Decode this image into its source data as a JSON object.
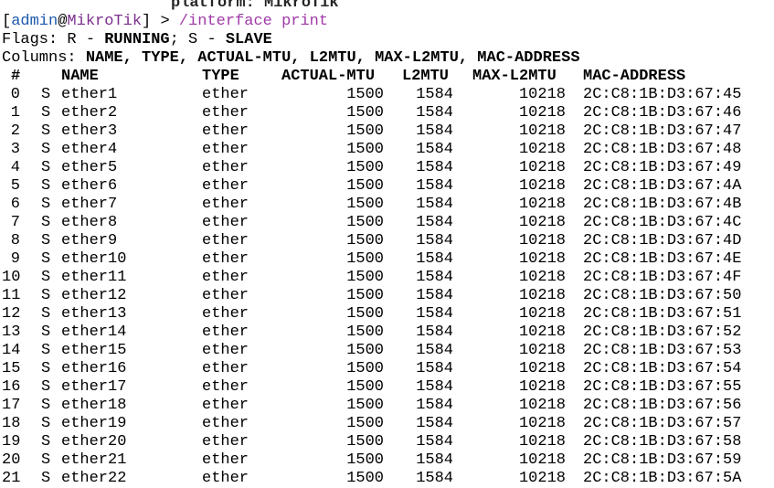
{
  "terminal": {
    "cut_top_line": "platform: MikroTik",
    "prompt": {
      "open_bracket": "[",
      "user": "admin",
      "at": "@",
      "host": "MikroTik",
      "close_bracket": "] > ",
      "command": "/interface print"
    },
    "flags": {
      "prefix": "Flags: R - ",
      "running": "RUNNING",
      "sep": "; S - ",
      "slave": "SLAVE"
    },
    "columns_line": {
      "prefix": "Columns: ",
      "list": "NAME, TYPE, ACTUAL-MTU, L2MTU, MAX-L2MTU, MAC-ADDRESS"
    },
    "headers": {
      "num": "#",
      "name": "NAME",
      "type": "TYPE",
      "actual_mtu": "ACTUAL-MTU",
      "l2mtu": "L2MTU",
      "max_l2mtu": "MAX-L2MTU",
      "mac": "MAC-ADDRESS"
    },
    "rows": [
      {
        "num": "0",
        "flag": "S",
        "name": "ether1",
        "type": "ether",
        "actual_mtu": "1500",
        "l2mtu": "1584",
        "max_l2mtu": "10218",
        "mac": "2C:C8:1B:D3:67:45"
      },
      {
        "num": "1",
        "flag": "S",
        "name": "ether2",
        "type": "ether",
        "actual_mtu": "1500",
        "l2mtu": "1584",
        "max_l2mtu": "10218",
        "mac": "2C:C8:1B:D3:67:46"
      },
      {
        "num": "2",
        "flag": "S",
        "name": "ether3",
        "type": "ether",
        "actual_mtu": "1500",
        "l2mtu": "1584",
        "max_l2mtu": "10218",
        "mac": "2C:C8:1B:D3:67:47"
      },
      {
        "num": "3",
        "flag": "S",
        "name": "ether4",
        "type": "ether",
        "actual_mtu": "1500",
        "l2mtu": "1584",
        "max_l2mtu": "10218",
        "mac": "2C:C8:1B:D3:67:48"
      },
      {
        "num": "4",
        "flag": "S",
        "name": "ether5",
        "type": "ether",
        "actual_mtu": "1500",
        "l2mtu": "1584",
        "max_l2mtu": "10218",
        "mac": "2C:C8:1B:D3:67:49"
      },
      {
        "num": "5",
        "flag": "S",
        "name": "ether6",
        "type": "ether",
        "actual_mtu": "1500",
        "l2mtu": "1584",
        "max_l2mtu": "10218",
        "mac": "2C:C8:1B:D3:67:4A"
      },
      {
        "num": "6",
        "flag": "S",
        "name": "ether7",
        "type": "ether",
        "actual_mtu": "1500",
        "l2mtu": "1584",
        "max_l2mtu": "10218",
        "mac": "2C:C8:1B:D3:67:4B"
      },
      {
        "num": "7",
        "flag": "S",
        "name": "ether8",
        "type": "ether",
        "actual_mtu": "1500",
        "l2mtu": "1584",
        "max_l2mtu": "10218",
        "mac": "2C:C8:1B:D3:67:4C"
      },
      {
        "num": "8",
        "flag": "S",
        "name": "ether9",
        "type": "ether",
        "actual_mtu": "1500",
        "l2mtu": "1584",
        "max_l2mtu": "10218",
        "mac": "2C:C8:1B:D3:67:4D"
      },
      {
        "num": "9",
        "flag": "S",
        "name": "ether10",
        "type": "ether",
        "actual_mtu": "1500",
        "l2mtu": "1584",
        "max_l2mtu": "10218",
        "mac": "2C:C8:1B:D3:67:4E"
      },
      {
        "num": "10",
        "flag": "S",
        "name": "ether11",
        "type": "ether",
        "actual_mtu": "1500",
        "l2mtu": "1584",
        "max_l2mtu": "10218",
        "mac": "2C:C8:1B:D3:67:4F"
      },
      {
        "num": "11",
        "flag": "S",
        "name": "ether12",
        "type": "ether",
        "actual_mtu": "1500",
        "l2mtu": "1584",
        "max_l2mtu": "10218",
        "mac": "2C:C8:1B:D3:67:50"
      },
      {
        "num": "12",
        "flag": "S",
        "name": "ether13",
        "type": "ether",
        "actual_mtu": "1500",
        "l2mtu": "1584",
        "max_l2mtu": "10218",
        "mac": "2C:C8:1B:D3:67:51"
      },
      {
        "num": "13",
        "flag": "S",
        "name": "ether14",
        "type": "ether",
        "actual_mtu": "1500",
        "l2mtu": "1584",
        "max_l2mtu": "10218",
        "mac": "2C:C8:1B:D3:67:52"
      },
      {
        "num": "14",
        "flag": "S",
        "name": "ether15",
        "type": "ether",
        "actual_mtu": "1500",
        "l2mtu": "1584",
        "max_l2mtu": "10218",
        "mac": "2C:C8:1B:D3:67:53"
      },
      {
        "num": "15",
        "flag": "S",
        "name": "ether16",
        "type": "ether",
        "actual_mtu": "1500",
        "l2mtu": "1584",
        "max_l2mtu": "10218",
        "mac": "2C:C8:1B:D3:67:54"
      },
      {
        "num": "16",
        "flag": "S",
        "name": "ether17",
        "type": "ether",
        "actual_mtu": "1500",
        "l2mtu": "1584",
        "max_l2mtu": "10218",
        "mac": "2C:C8:1B:D3:67:55"
      },
      {
        "num": "17",
        "flag": "S",
        "name": "ether18",
        "type": "ether",
        "actual_mtu": "1500",
        "l2mtu": "1584",
        "max_l2mtu": "10218",
        "mac": "2C:C8:1B:D3:67:56"
      },
      {
        "num": "18",
        "flag": "S",
        "name": "ether19",
        "type": "ether",
        "actual_mtu": "1500",
        "l2mtu": "1584",
        "max_l2mtu": "10218",
        "mac": "2C:C8:1B:D3:67:57"
      },
      {
        "num": "19",
        "flag": "S",
        "name": "ether20",
        "type": "ether",
        "actual_mtu": "1500",
        "l2mtu": "1584",
        "max_l2mtu": "10218",
        "mac": "2C:C8:1B:D3:67:58"
      },
      {
        "num": "20",
        "flag": "S",
        "name": "ether21",
        "type": "ether",
        "actual_mtu": "1500",
        "l2mtu": "1584",
        "max_l2mtu": "10218",
        "mac": "2C:C8:1B:D3:67:59"
      },
      {
        "num": "21",
        "flag": "S",
        "name": "ether22",
        "type": "ether",
        "actual_mtu": "1500",
        "l2mtu": "1584",
        "max_l2mtu": "10218",
        "mac": "2C:C8:1B:D3:67:5A"
      }
    ]
  }
}
